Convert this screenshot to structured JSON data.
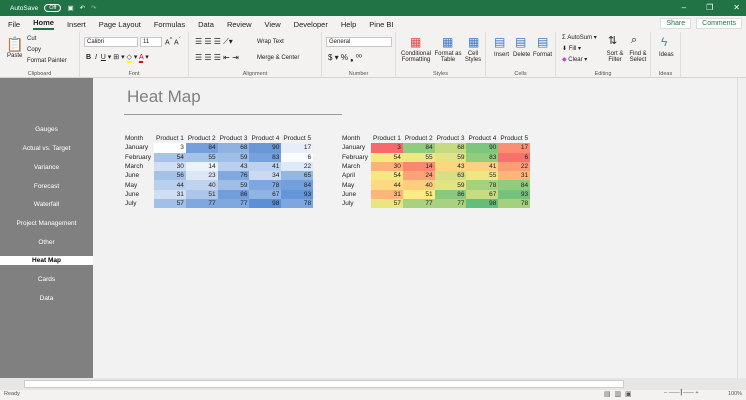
{
  "titlebar": {
    "autosave": "AutoSave",
    "toggle": "Off"
  },
  "tabs": [
    "File",
    "Home",
    "Insert",
    "Page Layout",
    "Formulas",
    "Data",
    "Review",
    "View",
    "Developer",
    "Help",
    "Pine BI"
  ],
  "share": "Share",
  "comments": "Comments",
  "ribbon": {
    "clipboard": {
      "paste": "Paste",
      "cut": "Cut",
      "copy": "Copy",
      "format_painter": "Format Painter",
      "label": "Clipboard"
    },
    "font": {
      "name": "Calibri",
      "size": "11",
      "label": "Font"
    },
    "alignment": {
      "wrap": "Wrap Text",
      "merge": "Merge & Center",
      "label": "Alignment"
    },
    "number": {
      "format": "General",
      "label": "Number"
    },
    "styles": {
      "cond": "Conditional Formatting",
      "table": "Format as Table",
      "cell": "Cell Styles",
      "label": "Styles"
    },
    "cells": {
      "insert": "Insert",
      "delete": "Delete",
      "format": "Format",
      "label": "Cells"
    },
    "editing": {
      "autosum": "AutoSum",
      "fill": "Fill",
      "clear": "Clear",
      "sort": "Sort & Filter",
      "find": "Find & Select",
      "label": "Editing"
    },
    "ideas": {
      "btn": "Ideas",
      "label": "Ideas"
    }
  },
  "sidebar": [
    "Gauges",
    "Actual vs. Target",
    "Variance",
    "Forecast",
    "Waterfall",
    "Project Management",
    "Other",
    "Heat Map",
    "Cards",
    "Data"
  ],
  "sidebar_active": 7,
  "page_title": "Heat Map",
  "colors": {
    "green": "#217346",
    "blue": "#5b8fd6",
    "red": "#f8696b",
    "yellow": "#ffeb84",
    "green_scale": "#63be7b"
  },
  "tables": [
    {
      "headers": [
        "Month",
        "Product 1",
        "Product 2",
        "Product 3",
        "Product 4",
        "Product 5"
      ],
      "scale": "blue",
      "rows": [
        [
          "January",
          3,
          84,
          68,
          90,
          17
        ],
        [
          "February",
          54,
          55,
          59,
          83,
          6
        ],
        [
          "March",
          30,
          14,
          43,
          41,
          22
        ],
        [
          "June",
          56,
          23,
          76,
          34,
          65
        ],
        [
          "May",
          44,
          40,
          59,
          78,
          84
        ],
        [
          "June",
          31,
          51,
          86,
          67,
          93
        ],
        [
          "July",
          57,
          77,
          77,
          98,
          78
        ]
      ]
    },
    {
      "headers": [
        "Month",
        "Product 1",
        "Product 2",
        "Product 3",
        "Product 4",
        "Product 5"
      ],
      "scale": "ryg",
      "rows": [
        [
          "January",
          3,
          84,
          68,
          90,
          17
        ],
        [
          "February",
          54,
          55,
          59,
          83,
          6
        ],
        [
          "March",
          30,
          14,
          43,
          41,
          22
        ],
        [
          "April",
          54,
          24,
          63,
          55,
          31
        ],
        [
          "May",
          44,
          40,
          59,
          78,
          84
        ],
        [
          "June",
          31,
          51,
          86,
          67,
          93
        ],
        [
          "July",
          57,
          77,
          77,
          98,
          78
        ]
      ]
    }
  ],
  "status": {
    "ready": "Ready",
    "zoom": "100%"
  }
}
